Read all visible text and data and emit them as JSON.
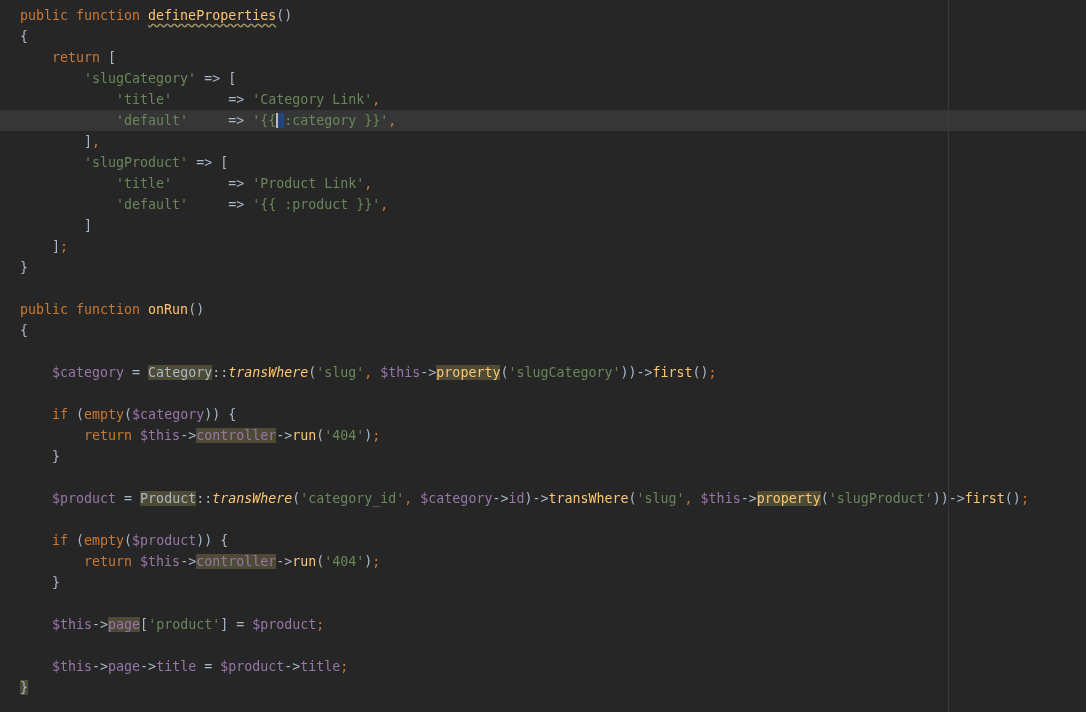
{
  "editor": {
    "lines": [
      {
        "current": false,
        "tokens": [
          {
            "kind": "kw",
            "text": "public function "
          },
          {
            "kind": "fn-warn",
            "text": "defineProperties"
          },
          {
            "kind": "plain",
            "text": "()"
          }
        ]
      },
      {
        "current": false,
        "tokens": [
          {
            "kind": "plain",
            "text": "{"
          }
        ]
      },
      {
        "current": false,
        "tokens": [
          {
            "kind": "kw",
            "text": "    return"
          },
          {
            "kind": "plain",
            "text": " ["
          }
        ]
      },
      {
        "current": false,
        "tokens": [
          {
            "kind": "str",
            "text": "        'slugCategory'"
          },
          {
            "kind": "plain",
            "text": " => ["
          }
        ]
      },
      {
        "current": false,
        "tokens": [
          {
            "kind": "str",
            "text": "            'title'"
          },
          {
            "kind": "plain",
            "text": "       => "
          },
          {
            "kind": "str",
            "text": "'Category Link'"
          },
          {
            "kind": "kw",
            "text": ","
          }
        ]
      },
      {
        "current": true,
        "tokens": [
          {
            "kind": "str",
            "text": "            'default'"
          },
          {
            "kind": "plain",
            "text": "     => "
          },
          {
            "kind": "str",
            "text": "'{{"
          },
          {
            "kind": "str-cursor",
            "text": " :category }}'"
          },
          {
            "kind": "kw",
            "text": ","
          }
        ]
      },
      {
        "current": false,
        "tokens": [
          {
            "kind": "plain",
            "text": "        ]"
          },
          {
            "kind": "kw",
            "text": ","
          }
        ]
      },
      {
        "current": false,
        "tokens": [
          {
            "kind": "str",
            "text": "        'slugProduct'"
          },
          {
            "kind": "plain",
            "text": " => ["
          }
        ]
      },
      {
        "current": false,
        "tokens": [
          {
            "kind": "str",
            "text": "            'title'"
          },
          {
            "kind": "plain",
            "text": "       => "
          },
          {
            "kind": "str",
            "text": "'Product Link'"
          },
          {
            "kind": "kw",
            "text": ","
          }
        ]
      },
      {
        "current": false,
        "tokens": [
          {
            "kind": "str",
            "text": "            'default'"
          },
          {
            "kind": "plain",
            "text": "     => "
          },
          {
            "kind": "str",
            "text": "'{{ :product }}'"
          },
          {
            "kind": "kw",
            "text": ","
          }
        ]
      },
      {
        "current": false,
        "tokens": [
          {
            "kind": "plain",
            "text": "        ]"
          }
        ]
      },
      {
        "current": false,
        "tokens": [
          {
            "kind": "plain",
            "text": "    ]"
          },
          {
            "kind": "kw",
            "text": ";"
          }
        ]
      },
      {
        "current": false,
        "tokens": [
          {
            "kind": "plain",
            "text": "}"
          }
        ]
      },
      {
        "current": false
      },
      {
        "current": false,
        "tokens": [
          {
            "kind": "kw",
            "text": "public function "
          },
          {
            "kind": "fn",
            "text": "onRun"
          },
          {
            "kind": "plain",
            "text": "()"
          }
        ]
      },
      {
        "current": false,
        "tokens": [
          {
            "kind": "plain",
            "text": "{"
          }
        ]
      },
      {
        "current": false
      },
      {
        "current": false,
        "tokens": [
          {
            "kind": "var",
            "text": "    $category"
          },
          {
            "kind": "plain",
            "text": " = "
          },
          {
            "kind": "hl-plain",
            "text": "Category"
          },
          {
            "kind": "plain",
            "text": "::"
          },
          {
            "kind": "fn-static",
            "text": "transWhere"
          },
          {
            "kind": "plain",
            "text": "("
          },
          {
            "kind": "str",
            "text": "'slug'"
          },
          {
            "kind": "kw",
            "text": ", "
          },
          {
            "kind": "var",
            "text": "$this"
          },
          {
            "kind": "plain",
            "text": "->"
          },
          {
            "kind": "hl-fn",
            "text": "property"
          },
          {
            "kind": "plain",
            "text": "("
          },
          {
            "kind": "str",
            "text": "'slugCategory'"
          },
          {
            "kind": "plain",
            "text": "))->"
          },
          {
            "kind": "fn",
            "text": "first"
          },
          {
            "kind": "plain",
            "text": "()"
          },
          {
            "kind": "kw",
            "text": ";"
          }
        ]
      },
      {
        "current": false
      },
      {
        "current": false,
        "tokens": [
          {
            "kind": "kw",
            "text": "    if"
          },
          {
            "kind": "plain",
            "text": " ("
          },
          {
            "kind": "kw",
            "text": "empty"
          },
          {
            "kind": "plain",
            "text": "("
          },
          {
            "kind": "var",
            "text": "$category"
          },
          {
            "kind": "plain",
            "text": ")) {"
          }
        ]
      },
      {
        "current": false,
        "tokens": [
          {
            "kind": "kw",
            "text": "        return "
          },
          {
            "kind": "var",
            "text": "$this"
          },
          {
            "kind": "plain",
            "text": "->"
          },
          {
            "kind": "hl-field",
            "text": "controller"
          },
          {
            "kind": "plain",
            "text": "->"
          },
          {
            "kind": "fn",
            "text": "run"
          },
          {
            "kind": "plain",
            "text": "("
          },
          {
            "kind": "str",
            "text": "'404'"
          },
          {
            "kind": "plain",
            "text": ")"
          },
          {
            "kind": "kw",
            "text": ";"
          }
        ]
      },
      {
        "current": false,
        "tokens": [
          {
            "kind": "plain",
            "text": "    }"
          }
        ]
      },
      {
        "current": false
      },
      {
        "current": false,
        "tokens": [
          {
            "kind": "var",
            "text": "    $product"
          },
          {
            "kind": "plain",
            "text": " = "
          },
          {
            "kind": "hl-plain",
            "text": "Product"
          },
          {
            "kind": "plain",
            "text": "::"
          },
          {
            "kind": "fn-static",
            "text": "transWhere"
          },
          {
            "kind": "plain",
            "text": "("
          },
          {
            "kind": "str",
            "text": "'category_id'"
          },
          {
            "kind": "kw",
            "text": ", "
          },
          {
            "kind": "var",
            "text": "$category"
          },
          {
            "kind": "plain",
            "text": "->"
          },
          {
            "kind": "field",
            "text": "id"
          },
          {
            "kind": "plain",
            "text": ")->"
          },
          {
            "kind": "fn",
            "text": "transWhere"
          },
          {
            "kind": "plain",
            "text": "("
          },
          {
            "kind": "str",
            "text": "'slug'"
          },
          {
            "kind": "kw",
            "text": ", "
          },
          {
            "kind": "var",
            "text": "$this"
          },
          {
            "kind": "plain",
            "text": "->"
          },
          {
            "kind": "hl-fn",
            "text": "property"
          },
          {
            "kind": "plain",
            "text": "("
          },
          {
            "kind": "str",
            "text": "'slugProduct'"
          },
          {
            "kind": "plain",
            "text": "))->"
          },
          {
            "kind": "fn",
            "text": "first"
          },
          {
            "kind": "plain",
            "text": "()"
          },
          {
            "kind": "kw",
            "text": ";"
          }
        ]
      },
      {
        "current": false
      },
      {
        "current": false,
        "tokens": [
          {
            "kind": "kw",
            "text": "    if"
          },
          {
            "kind": "plain",
            "text": " ("
          },
          {
            "kind": "kw",
            "text": "empty"
          },
          {
            "kind": "plain",
            "text": "("
          },
          {
            "kind": "var",
            "text": "$product"
          },
          {
            "kind": "plain",
            "text": ")) {"
          }
        ]
      },
      {
        "current": false,
        "tokens": [
          {
            "kind": "kw",
            "text": "        return "
          },
          {
            "kind": "var",
            "text": "$this"
          },
          {
            "kind": "plain",
            "text": "->"
          },
          {
            "kind": "hl-field",
            "text": "controller"
          },
          {
            "kind": "plain",
            "text": "->"
          },
          {
            "kind": "fn",
            "text": "run"
          },
          {
            "kind": "plain",
            "text": "("
          },
          {
            "kind": "str",
            "text": "'404'"
          },
          {
            "kind": "plain",
            "text": ")"
          },
          {
            "kind": "kw",
            "text": ";"
          }
        ]
      },
      {
        "current": false,
        "tokens": [
          {
            "kind": "plain",
            "text": "    }"
          }
        ]
      },
      {
        "current": false
      },
      {
        "current": false,
        "tokens": [
          {
            "kind": "var",
            "text": "    $this"
          },
          {
            "kind": "plain",
            "text": "->"
          },
          {
            "kind": "hl-field",
            "text": "page"
          },
          {
            "kind": "plain",
            "text": "["
          },
          {
            "kind": "str",
            "text": "'product'"
          },
          {
            "kind": "plain",
            "text": "] = "
          },
          {
            "kind": "var",
            "text": "$product"
          },
          {
            "kind": "kw",
            "text": ";"
          }
        ]
      },
      {
        "current": false
      },
      {
        "current": false,
        "tokens": [
          {
            "kind": "var",
            "text": "    $this"
          },
          {
            "kind": "plain",
            "text": "->"
          },
          {
            "kind": "field",
            "text": "page"
          },
          {
            "kind": "plain",
            "text": "->"
          },
          {
            "kind": "field",
            "text": "title"
          },
          {
            "kind": "plain",
            "text": " = "
          },
          {
            "kind": "var",
            "text": "$product"
          },
          {
            "kind": "plain",
            "text": "->"
          },
          {
            "kind": "field",
            "text": "title"
          },
          {
            "kind": "kw",
            "text": ";"
          }
        ]
      },
      {
        "current": false,
        "tokens": [
          {
            "kind": "hl-plain",
            "text": "}"
          }
        ]
      }
    ]
  }
}
